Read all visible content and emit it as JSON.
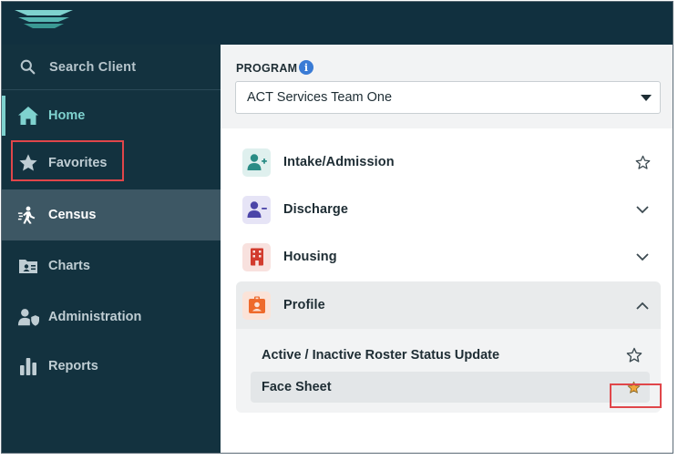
{
  "sidebar": {
    "search_label": "Search Client",
    "items": [
      {
        "label": "Home",
        "icon": "home-icon"
      },
      {
        "label": "Favorites",
        "icon": "star-icon"
      },
      {
        "label": "Census",
        "icon": "census-icon"
      },
      {
        "label": "Charts",
        "icon": "charts-folder-icon"
      },
      {
        "label": "Administration",
        "icon": "user-shield-icon"
      },
      {
        "label": "Reports",
        "icon": "bar-chart-icon"
      }
    ],
    "active": "Census",
    "accent_color": "#7fd2cf"
  },
  "program": {
    "label": "PROGRAM",
    "info_glyph": "i",
    "selected": "ACT Services Team One"
  },
  "menu": [
    {
      "label": "Intake/Admission",
      "icon": "user-plus-icon",
      "control": "star-outline"
    },
    {
      "label": "Discharge",
      "icon": "user-minus-icon",
      "control": "chevron-down"
    },
    {
      "label": "Housing",
      "icon": "building-icon",
      "control": "chevron-down"
    },
    {
      "label": "Profile",
      "icon": "id-badge-icon",
      "control": "chevron-up",
      "expanded": true
    }
  ],
  "profile_items": [
    {
      "label": "Active / Inactive Roster Status Update",
      "favorite": false
    },
    {
      "label": "Face Sheet",
      "favorite": true
    }
  ],
  "colors": {
    "topbar": "#11303f",
    "sidebar": "#13323f",
    "highlight": "#e0464a",
    "star_filled": "#f0a63a"
  }
}
